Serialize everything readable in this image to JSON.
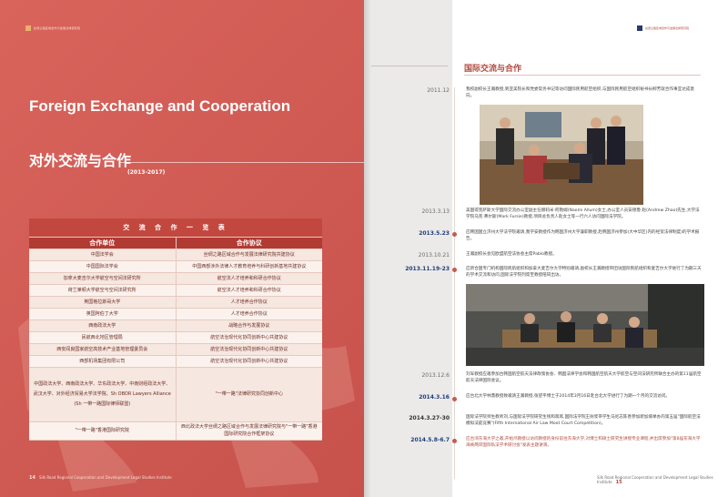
{
  "left": {
    "header": "丝绸之路区域合作与发展法律研究院",
    "title_en": "Foreign Exchange and Cooperation",
    "title_cn": "对外交流与合作",
    "years": "(2013-2017)",
    "table": {
      "caption": "交 流 合 作 一 览 表",
      "headers": [
        "合作单位",
        "合作协议"
      ],
      "rows": [
        [
          "中国法学会",
          "丝绸之路区域合作与发展法律研究院共建协议"
        ],
        [
          "中国国际法学会",
          "中国西部涉外法律人才教育培养与科研创新基地共建协议"
        ],
        [
          "加拿大麦吉尔大学航空与空间法研究所",
          "航空法人才培养和科研合作协议"
        ],
        [
          "荷兰莱顿大学航空与空间法研究所",
          "航空法人才培养和科研合作协议"
        ],
        [
          "英国格拉斯哥大学",
          "人才培养合作协议"
        ],
        [
          "英国阿伯丁大学",
          "人才培养合作协议"
        ],
        [
          "西南政法大学",
          "战略合作与发展协议"
        ],
        [
          "民航西北地区管理局",
          "航空法治现代化协同创新中心共建协议"
        ],
        [
          "西安阎良国家航空高技术产业基地管理委员会",
          "航空法治现代化协同创新中心共建协议"
        ],
        [
          "西部机场集团有限公司",
          "航空法治现代化协同创新中心共建协议"
        ],
        [
          "中国政法大学、西南政法大学、华东政法大学、中南财经政法大学、武汉大学、对外经济贸易大学法学院、Sh OBOR Lawyers Alliance (Sh 一带一路国际律师联盟)",
          "\"一带一路\"法律研究协同创新中心"
        ],
        [
          "\"一带一路\"香港国际研究院",
          "西北政法大学丝绸之路区域合作与发展法律研究院与\"一带一路\"香港国际研究院合作框架协议"
        ]
      ]
    },
    "footer_page": "14",
    "footer_text": "Silk Road Regional Cooperation and Development Legal Studies Institute"
  },
  "right": {
    "header": "丝绸之路区域合作与发展法律研究院",
    "section_title": "国际交流与合作",
    "entries": [
      {
        "date": "2011.12",
        "text": "我校副校长王瀚教授,到亚美院长和党委常务书记等访问国际民用航空组织,与国际民用航空组织秘书长柳芳就合作事宜达成意向。"
      },
      {
        "date": "2013.3.13",
        "text": "美国得克萨斯大学国际交流办公室副主任赫莉米·阿勒姆(Naomi Allum)女士,办公室人员安德鲁·赵(Andrew Zhao)先生,大学法学院马克·弗尔斯(Mark Fursie)教授,项目总负责人赵女士等一行六人访问国际法学院。"
      },
      {
        "date": "2013.5.23",
        "text": "应韩国国立济州大学法学院邀请,我学安教授作为韩国济州大学兼职教授,赴韩国济州参加(大中华区)内的经贸法律制度)的学术报告。"
      },
      {
        "date": "2013.10.21",
        "text": "王瀚副校长会见欧盟航空法协会主席Pablo教授。"
      },
      {
        "date": "2013.11.19-23",
        "text": "应新合国专门机构国际民航组织和加拿大麦吉尔大学特别邀请,副校长王瀚教授带团访国际民航组织和麦吉尔大学进行了为期三天的学术交流和访问,国际法学院列席至教授陪同出访。"
      },
      {
        "date": "2013.12.6",
        "text": "刘军教授应邀参加台韩国航空航天法律政策协会、韩国法律学会和韩国航空航天大学航空与空间法研究所联合主办的第11届航空航天法律国际会议。"
      },
      {
        "date": "2014.3.16",
        "text": "应台北大学林鼎教授致邀请王瀚教授,张望平博士于2014年3月16日赴台北大学进行了为期一个月的交流访问。"
      },
      {
        "date": "2014.3.27-30",
        "text": "国际法学院师生教师刘,与国际法学院研究生钱和蒋蒋,国际法学院王树浆带学生马尼志陈善参加新加坡举办的第五届\"国际航空法模拟法庭竞赛\"(Fifth International Air Law Moot Court Competition)。"
      },
      {
        "date": "2014.5.8-6.7",
        "text": "应台湾东海大学之邀,开始鸿教授以访问教授的身份前往东海大学,对博士和硕士研究生讲授专业课程,并出席参加\"第8届东海大学海峡两岸国际私法学术研讨会\"发表主题讲演。"
      }
    ],
    "footer_text": "Silk Road Regional Cooperation and Development Legal Studies Institute",
    "footer_page": "15"
  }
}
